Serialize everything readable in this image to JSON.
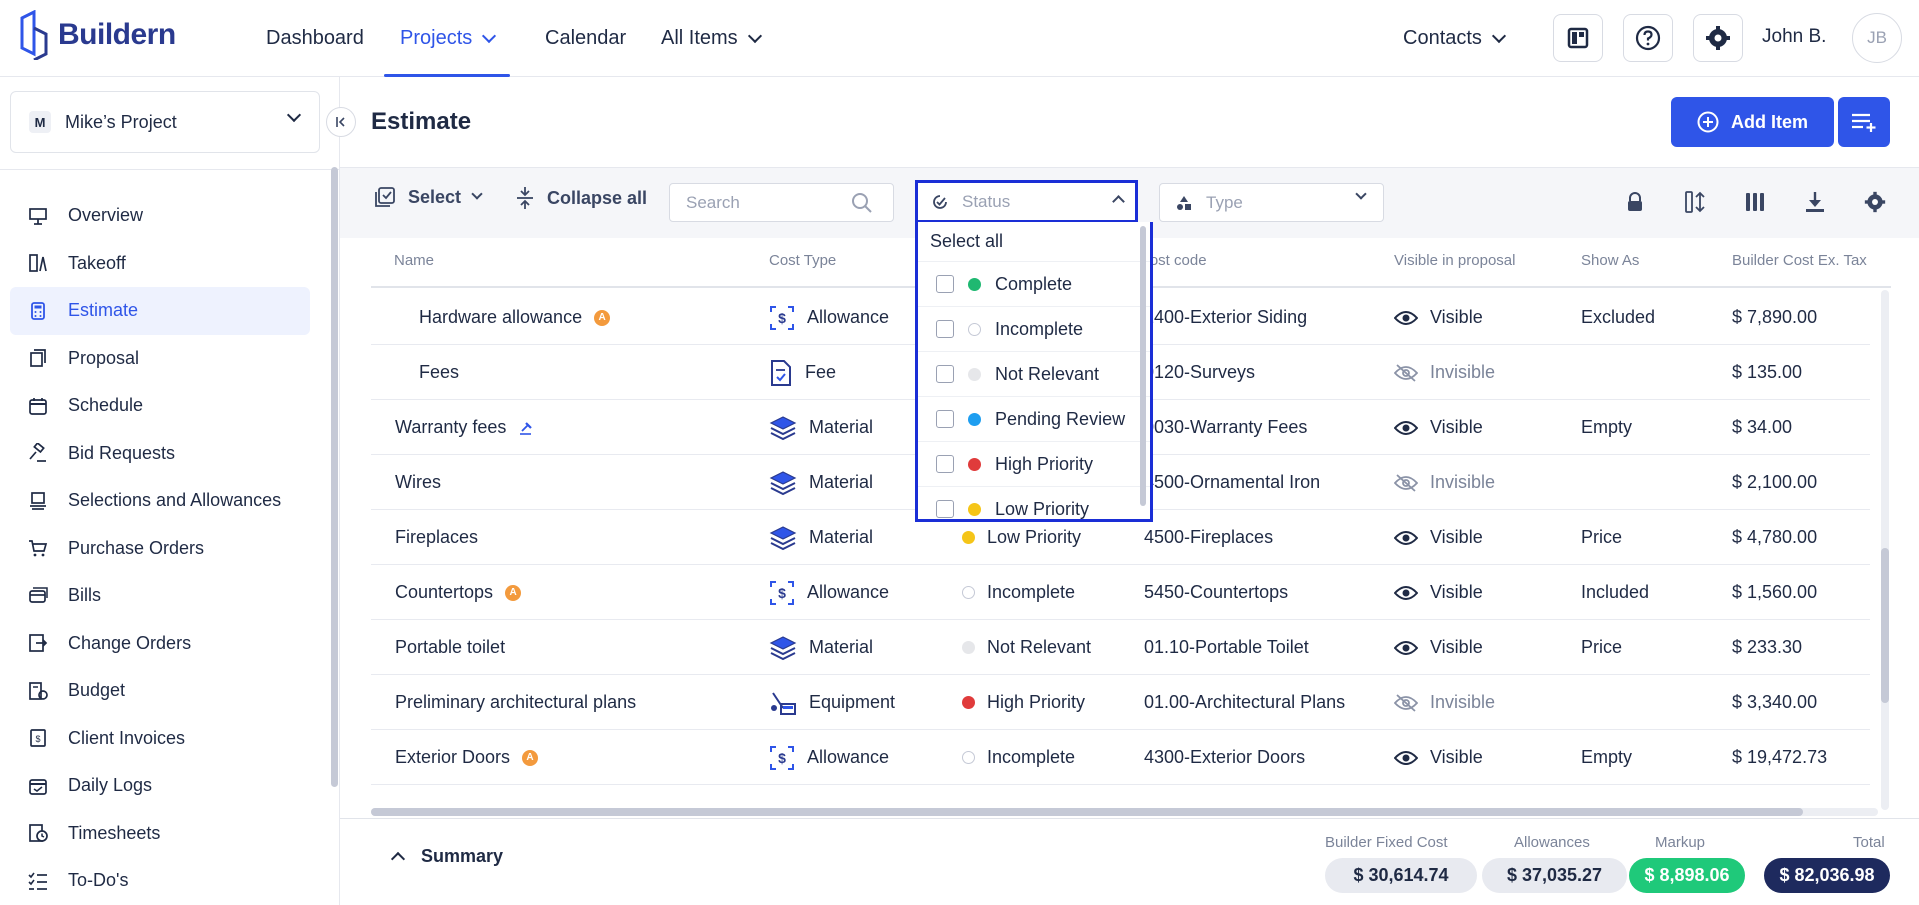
{
  "app": {
    "name": "Buildern"
  },
  "nav": {
    "dashboard": "Dashboard",
    "projects": "Projects",
    "calendar": "Calendar",
    "all_items": "All Items",
    "contacts": "Contacts",
    "user_name": "John B.",
    "user_initials": "JB"
  },
  "sidebar": {
    "project_badge": "M",
    "project_name": "Mike’s Project",
    "items": [
      {
        "label": "Overview",
        "icon": "presentation-icon"
      },
      {
        "label": "Takeoff",
        "icon": "takeoff-icon"
      },
      {
        "label": "Estimate",
        "icon": "calculator-icon"
      },
      {
        "label": "Proposal",
        "icon": "proposal-icon"
      },
      {
        "label": "Schedule",
        "icon": "calendar-icon"
      },
      {
        "label": "Bid Requests",
        "icon": "gavel-icon"
      },
      {
        "label": "Selections and Allowances",
        "icon": "selections-icon"
      },
      {
        "label": "Purchase Orders",
        "icon": "cart-icon"
      },
      {
        "label": "Bills",
        "icon": "bills-icon"
      },
      {
        "label": "Change Orders",
        "icon": "change-orders-icon"
      },
      {
        "label": "Budget",
        "icon": "budget-icon"
      },
      {
        "label": "Client Invoices",
        "icon": "invoice-icon"
      },
      {
        "label": "Daily Logs",
        "icon": "daily-log-icon"
      },
      {
        "label": "Timesheets",
        "icon": "timesheet-icon"
      },
      {
        "label": "To-Do's",
        "icon": "todo-icon"
      }
    ]
  },
  "page": {
    "title": "Estimate",
    "add_item": "Add Item"
  },
  "toolbar": {
    "select": "Select",
    "collapse_all": "Collapse all",
    "search_placeholder": "Search",
    "status_placeholder": "Status",
    "type_placeholder": "Type"
  },
  "table": {
    "headers": [
      "Name",
      "Cost Type",
      "Cost code",
      "Visible in proposal",
      "Show As",
      "Builder Cost Ex. Tax"
    ],
    "rows": [
      {
        "name": "Hardware allowance",
        "marker": "A",
        "cost_type": "Allowance",
        "status": "",
        "cost_code": "2400-Exterior Siding",
        "visible": "Visible",
        "show_as": "Excluded",
        "cost": "$ 7,890.00"
      },
      {
        "name": "Fees",
        "marker": "",
        "cost_type": "Fee",
        "status": "",
        "cost_code": "0120-Surveys",
        "visible": "Invisible",
        "show_as": "",
        "cost": "$ 135.00"
      },
      {
        "name": "Warranty fees",
        "marker": "bid",
        "cost_type": "Material",
        "status": "",
        "cost_code": "0030-Warranty Fees",
        "visible": "Visible",
        "show_as": "Empty",
        "cost": "$ 34.00"
      },
      {
        "name": "Wires",
        "marker": "",
        "cost_type": "Material",
        "status": "",
        "cost_code": "4500-Ornamental Iron",
        "visible": "Invisible",
        "show_as": "",
        "cost": "$ 2,100.00"
      },
      {
        "name": "Fireplaces",
        "marker": "",
        "cost_type": "Material",
        "status": "Low Priority",
        "cost_code": "4500-Fireplaces",
        "visible": "Visible",
        "show_as": "Price",
        "cost": "$ 4,780.00"
      },
      {
        "name": "Countertops",
        "marker": "A",
        "cost_type": "Allowance",
        "status": "Incomplete",
        "cost_code": "5450-Countertops",
        "visible": "Visible",
        "show_as": "Included",
        "cost": "$ 1,560.00"
      },
      {
        "name": "Portable toilet",
        "marker": "",
        "cost_type": "Material",
        "status": "Not Relevant",
        "cost_code": "01.10-Portable Toilet",
        "visible": "Visible",
        "show_as": "Price",
        "cost": "$ 233.30"
      },
      {
        "name": "Preliminary architectural plans",
        "marker": "",
        "cost_type": "Equipment",
        "status": "High Priority",
        "cost_code": "01.00-Architectural Plans",
        "visible": "Invisible",
        "show_as": "",
        "cost": "$ 3,340.00"
      },
      {
        "name": "Exterior Doors",
        "marker": "A",
        "cost_type": "Allowance",
        "status": "Incomplete",
        "cost_code": "4300-Exterior Doors",
        "visible": "Visible",
        "show_as": "Empty",
        "cost": "$ 19,472.73"
      }
    ]
  },
  "status_dropdown": {
    "select_all": "Select all",
    "options": [
      {
        "label": "Complete",
        "color": "#1fb871"
      },
      {
        "label": "Incomplete",
        "color": "hollow"
      },
      {
        "label": "Not Relevant",
        "color": "#e6e7ea"
      },
      {
        "label": "Pending Review",
        "color": "#1e9ef0"
      },
      {
        "label": "High Priority",
        "color": "#e03b3b"
      },
      {
        "label": "Low Priority",
        "color": "#f5c518"
      }
    ]
  },
  "status_colors": {
    "Low Priority": "#f5c518",
    "Incomplete": "hollow",
    "Not Relevant": "#e6e7ea",
    "High Priority": "#e03b3b"
  },
  "summary": {
    "toggle": "Summary",
    "builder_fixed_cost_label": "Builder Fixed Cost",
    "builder_fixed_cost": "$ 30,614.74",
    "allowances_label": "Allowances",
    "allowances": "$ 37,035.27",
    "markup_label": "Markup",
    "markup": "$ 8,898.06",
    "total_label": "Total",
    "total": "$ 82,036.98"
  },
  "colors": {
    "accent": "#2f55e8",
    "dropdown_border": "#1a2ed6",
    "markup_pill": "#1fc97a",
    "total_pill": "#1e2a5e"
  }
}
